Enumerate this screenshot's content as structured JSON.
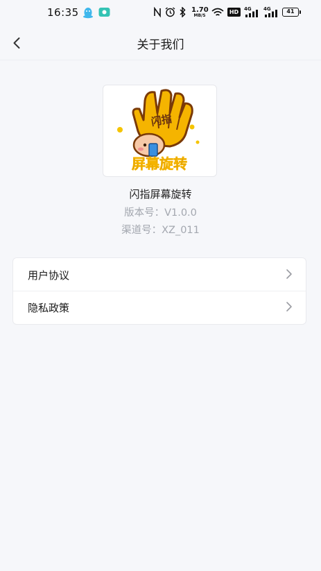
{
  "status_bar": {
    "time": "16:35",
    "network_speed_value": "1.70",
    "network_speed_unit": "MB/S",
    "hd_label": "HD",
    "signal1_label": "4G",
    "signal2_label": "4G",
    "battery": "41"
  },
  "nav": {
    "title": "关于我们"
  },
  "logo": {
    "top_text": "闪指",
    "bottom_text": "屏幕旋转"
  },
  "app_info": {
    "name": "闪指屏幕旋转",
    "version": "版本号：V1.0.0",
    "channel": "渠道号：XZ_011"
  },
  "menu": {
    "items": [
      {
        "label": "用户协议"
      },
      {
        "label": "隐私政策"
      }
    ]
  },
  "colors": {
    "background": "#f6f7fa",
    "secondary_text": "#a3a7af",
    "logo_gold": "#f5b400",
    "logo_text_brown": "#6b3410"
  }
}
